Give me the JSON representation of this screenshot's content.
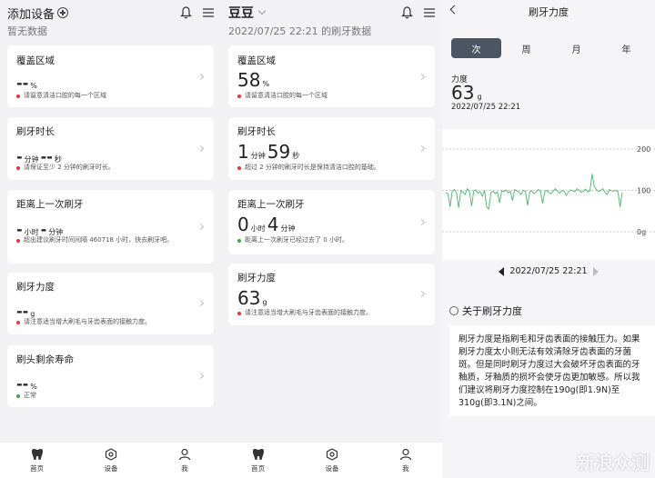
{
  "panel1": {
    "title": "添加设备",
    "subtitle": "暂无数据",
    "cards": [
      {
        "title": "覆盖区域",
        "value": "--",
        "unit": "%",
        "note": "请留意清洁口腔的每一个区域",
        "dot": "#e53935"
      },
      {
        "title": "刷牙时长",
        "v1": "-",
        "u1": "分钟",
        "v2": "--",
        "u2": "秒",
        "note": "请保证至少 2 分钟的刷牙时长。",
        "dot": "#e53935"
      },
      {
        "title": "距离上一次刷牙",
        "v1": "-",
        "u1": "小时",
        "v2": "-",
        "u2": "分钟",
        "note": "超出建议刷牙时间间隔 460718 小时，快去刷牙吧。",
        "dot": "#e53935"
      },
      {
        "title": "刷牙力度",
        "value": "--",
        "unit": "g",
        "note": "请注意适当增大刷毛与牙齿表面的接触力度。",
        "dot": "#e53935"
      },
      {
        "title": "刷头剩余寿命",
        "value": "--",
        "unit": "%",
        "note": "正常",
        "dot": "#43a047"
      }
    ]
  },
  "panel2": {
    "title": "豆豆",
    "subtitle": "2022/07/25 22:21 的刷牙数据",
    "cards": [
      {
        "title": "覆盖区域",
        "value": "58",
        "unit": "%",
        "note": "请留意清洁口腔的每一个区域",
        "dot": "#e53935"
      },
      {
        "title": "刷牙时长",
        "v1": "1",
        "u1": "分钟",
        "v2": "59",
        "u2": "秒",
        "note": "超过 2 分钟的刷牙时长是保持清洁口腔的基础。",
        "dot": "#e53935"
      },
      {
        "title": "距离上一次刷牙",
        "v1": "0",
        "u1": "小时",
        "v2": "4",
        "u2": "分钟",
        "note": "距离上一次刷牙已经过去了 0 小时。",
        "dot": "#43a047"
      },
      {
        "title": "刷牙力度",
        "value": "63",
        "unit": "g",
        "note": "请注意适当增大刷毛与牙齿表面的接触力度。",
        "dot": "#e53935"
      }
    ]
  },
  "nav": {
    "home": "首页",
    "device": "设备",
    "me": "我"
  },
  "panel3": {
    "title": "刷牙力度",
    "tabs": [
      "次",
      "周",
      "月",
      "年"
    ],
    "label": "力度",
    "value": "63",
    "unit": "g",
    "timestamp": "2022/07/25 22:21",
    "date": "2022/07/25 22:21",
    "about_title": "关于刷牙力度",
    "description": "刷牙力度是指刷毛和牙齿表面的接触压力。如果刷牙力度太小则无法有效清除牙齿表面的牙菌斑。但是同时刷牙力度过大会破坏牙齿表面的牙釉质，牙釉质的损坏会使牙齿更加敏感。所以我们建议将刷牙力度控制在190g(即1.9N)至 310g(即3.1N)之间。",
    "watermark": "新浪众测"
  },
  "chart_data": {
    "type": "line",
    "ytick_labels": [
      "200",
      "100",
      "0g"
    ],
    "ylim": [
      0,
      200
    ],
    "color": "#5cb87a",
    "values": [
      95,
      92,
      60,
      98,
      102,
      94,
      58,
      100,
      96,
      90,
      104,
      97,
      62,
      99,
      101,
      93,
      97,
      86,
      100,
      60,
      55,
      95,
      98,
      92,
      96,
      70,
      99,
      97,
      101,
      94,
      98,
      75,
      102,
      99,
      96,
      90,
      100,
      98,
      64,
      96,
      99,
      92,
      96,
      102,
      98,
      68,
      97,
      100,
      95,
      92,
      99,
      104,
      97,
      93,
      100,
      98,
      88,
      96,
      101,
      99,
      97,
      104,
      100,
      95,
      98,
      103,
      96,
      99,
      140,
      110,
      102,
      97,
      100,
      104,
      95,
      90,
      102,
      99,
      98,
      100,
      97,
      60,
      95
    ]
  }
}
